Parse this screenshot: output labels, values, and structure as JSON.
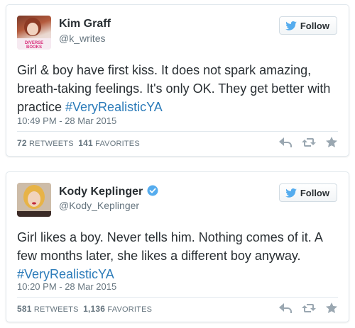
{
  "tweets": [
    {
      "name": "Kim Graff",
      "handle": "@k_writes",
      "verified": false,
      "avatar_text": "DIVERSE BOOKS",
      "follow_label": "Follow",
      "text": "Girl & boy have first kiss. It does not spark amazing, breath-taking feelings. It's only OK. They get better with practice ",
      "hashtag": "#VeryRealisticYA",
      "timestamp": "10:49 PM - 28 Mar 2015",
      "retweets": "72",
      "retweets_label": "RETWEETS",
      "favorites": "141",
      "favorites_label": "FAVORITES"
    },
    {
      "name": "Kody Keplinger",
      "handle": "@Kody_Keplinger",
      "verified": true,
      "follow_label": "Follow",
      "text": "Girl likes a boy. Never tells him. Nothing comes of it. A few months later, she likes a different boy anyway. ",
      "hashtag": "#VeryRealisticYA",
      "timestamp": "10:20 PM - 28 Mar 2015",
      "retweets": "581",
      "retweets_label": "RETWEETS",
      "favorites": "1,136",
      "favorites_label": "FAVORITES"
    }
  ],
  "icons": {
    "bird": "twitter-bird-icon",
    "verified": "verified-badge-icon",
    "reply": "reply-icon",
    "retweet": "retweet-icon",
    "favorite": "star-icon"
  },
  "colors": {
    "link": "#2b7bb9",
    "twitter_blue": "#55acee",
    "muted": "#66757f",
    "action_icon": "#9aa7b1"
  }
}
